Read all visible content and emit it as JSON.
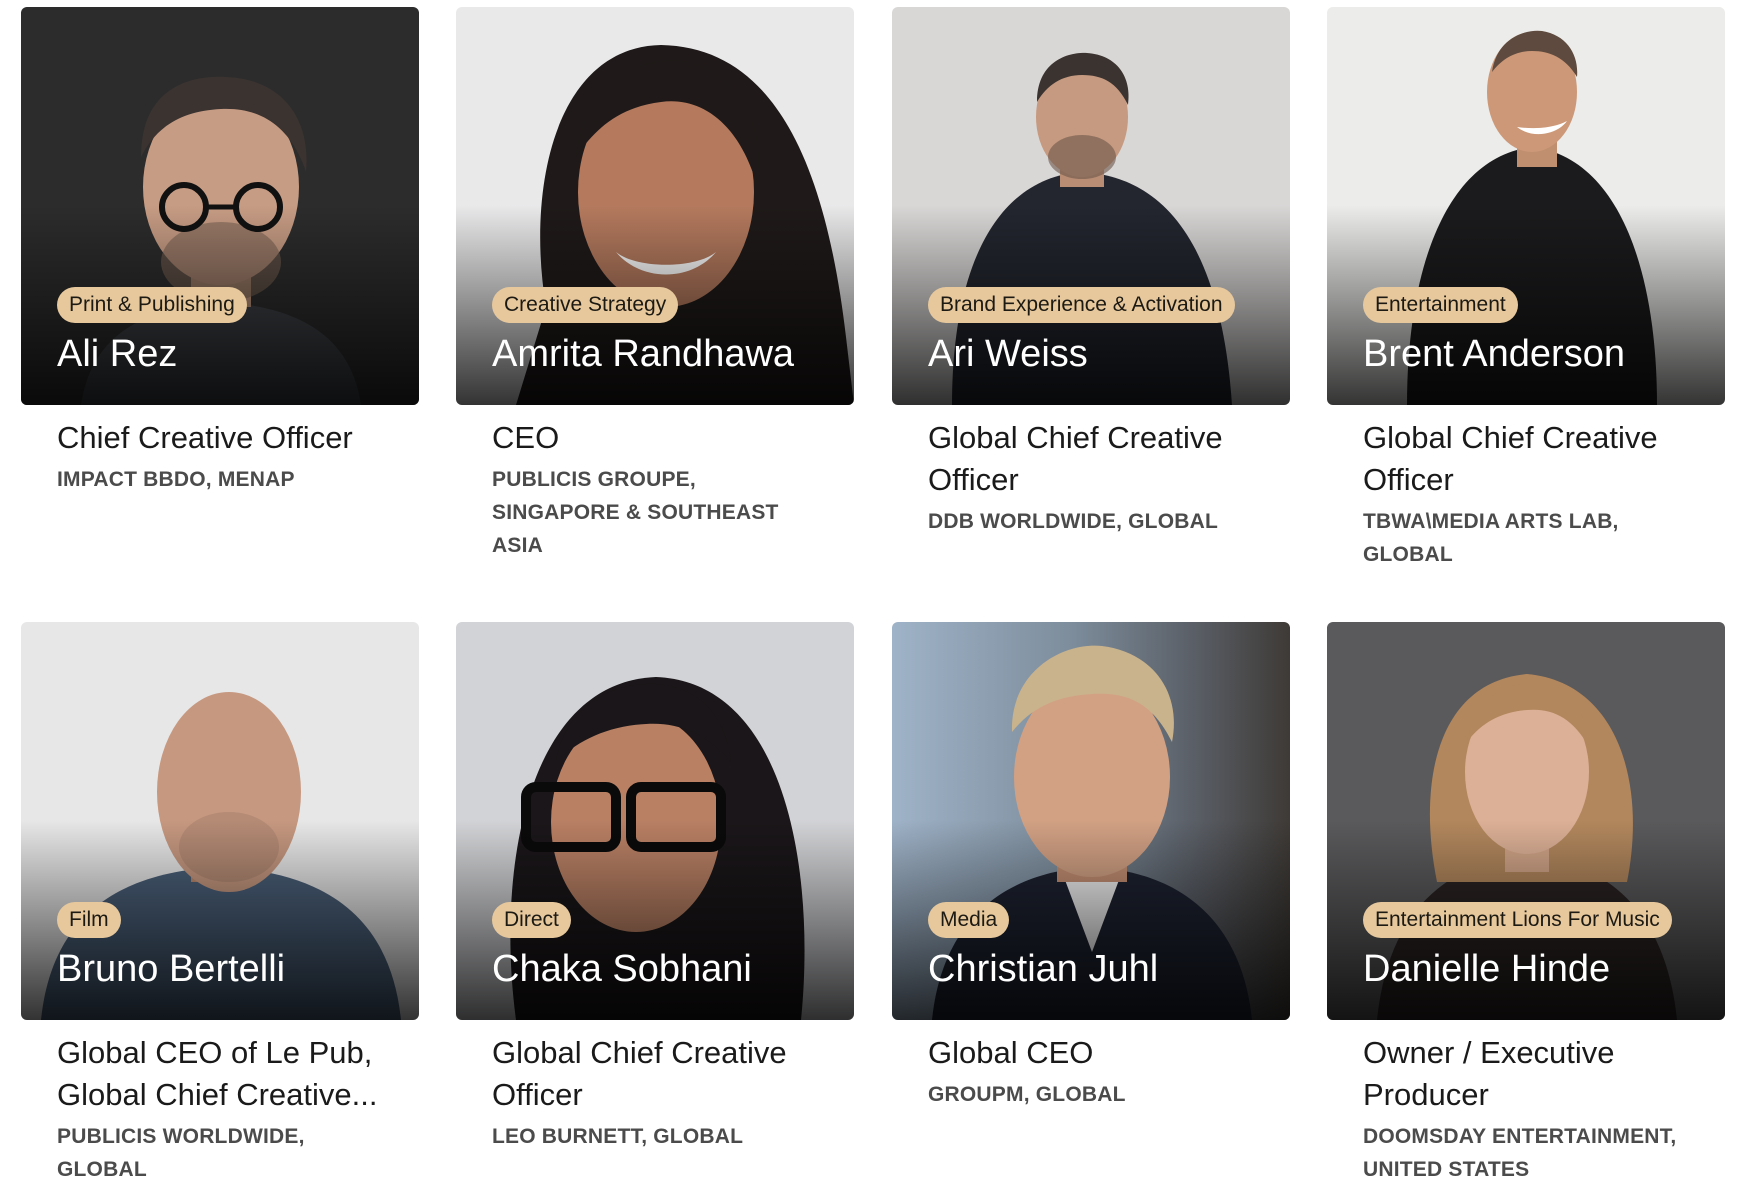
{
  "jurors": [
    {
      "tag": "Print & Publishing",
      "name": "Ali Rez",
      "role": "Chief Creative Officer",
      "company": "IMPACT BBDO, MENAP",
      "bg_color": "#2c2c2c"
    },
    {
      "tag": "Creative Strategy",
      "name": "Amrita Randhawa",
      "role": "CEO",
      "company": "PUBLICIS GROUPE, SINGAPORE & SOUTHEAST ASIA",
      "bg_color": "#e9e9ea"
    },
    {
      "tag": "Brand Experience & Activation",
      "name": "Ari Weiss",
      "role": "Global Chief Creative Officer",
      "company": "DDB WORLDWIDE, GLOBAL",
      "bg_color": "#d9d7d6"
    },
    {
      "tag": "Entertainment",
      "name": "Brent Anderson",
      "role": "Global Chief Creative Officer",
      "company": "TBWA\\MEDIA ARTS LAB, GLOBAL",
      "bg_color": "#ececea"
    },
    {
      "tag": "Film",
      "name": "Bruno Bertelli",
      "role": "Global CEO of Le Pub, Global Chief Creative...",
      "company": "PUBLICIS WORLDWIDE, GLOBAL",
      "bg_color": "#e7e7e7"
    },
    {
      "tag": "Direct",
      "name": "Chaka Sobhani",
      "role": "Global Chief Creative Officer",
      "company": "LEO BURNETT, GLOBAL",
      "bg_color": "#d2d3d6"
    },
    {
      "tag": "Media",
      "name": "Christian Juhl",
      "role": "Global CEO",
      "company": "GROUPM, GLOBAL",
      "bg_color": "#8a97a6"
    },
    {
      "tag": "Entertainment Lions For Music",
      "name": "Danielle Hinde",
      "role": "Owner / Executive Producer",
      "company": "DOOMSDAY ENTERTAINMENT, UNITED STATES",
      "bg_color": "#5a5a5c"
    }
  ],
  "colors": {
    "tag_bg": "#e6c89c",
    "company_text": "#4b4b4b"
  }
}
